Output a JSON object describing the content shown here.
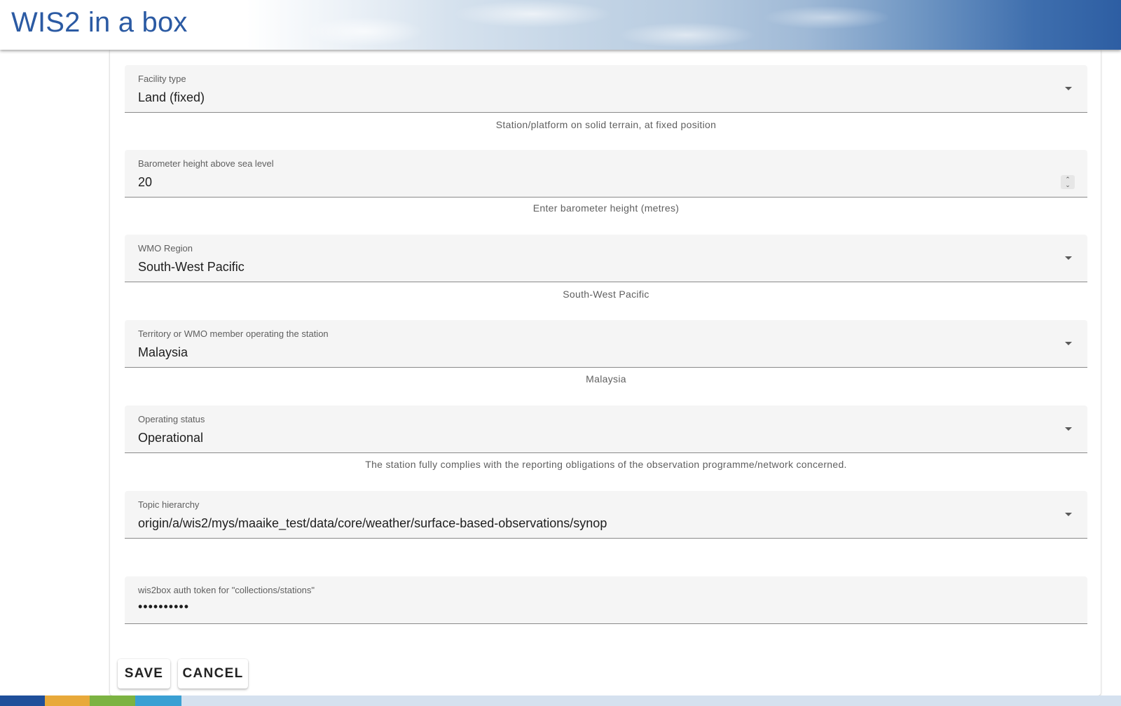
{
  "app": {
    "title": "WIS2 in a box"
  },
  "form": {
    "facility_type": {
      "label": "Facility type",
      "value": "Land (fixed)",
      "hint": "Station/platform on solid terrain, at fixed position"
    },
    "barometer_height": {
      "label": "Barometer height above sea level",
      "value": "20",
      "hint": "Enter barometer height (metres)"
    },
    "wmo_region": {
      "label": "WMO Region",
      "value": "South-West Pacific",
      "hint": "South-West Pacific"
    },
    "territory": {
      "label": "Territory or WMO member operating the station",
      "value": "Malaysia",
      "hint": "Malaysia"
    },
    "operating_status": {
      "label": "Operating status",
      "value": "Operational",
      "hint": "The station fully complies with the reporting obligations of the observation programme/network concerned."
    },
    "topic_hierarchy": {
      "label": "Topic hierarchy",
      "value": "origin/a/wis2/mys/maaike_test/data/core/weather/surface-based-observations/synop"
    },
    "auth_token": {
      "label": "wis2box auth token for \"collections/stations\"",
      "value": "••••••••••"
    }
  },
  "actions": {
    "save_label": "SAVE",
    "cancel_label": "CANCEL"
  },
  "icons": {
    "dropdown": "caret-down-icon",
    "stepper": "number-stepper-icon"
  },
  "colors": {
    "brand_blue": "#2b5aa3",
    "footer_blue": "#1f4f9a",
    "footer_orange": "#e8a93a",
    "footer_green": "#7cb342",
    "footer_cyan": "#3aa0d3",
    "footer_light": "#d5e1ef"
  }
}
